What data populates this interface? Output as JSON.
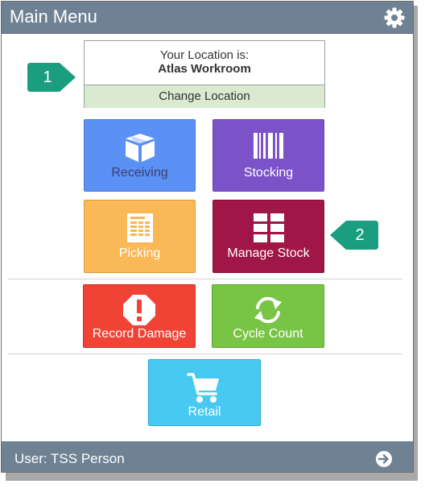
{
  "header": {
    "title": "Main Menu",
    "settings_icon": "gear-icon"
  },
  "location": {
    "label": "Your Location is:",
    "name": "Atlas Workroom",
    "change_label": "Change Location"
  },
  "tiles": {
    "receiving": {
      "label": "Receiving",
      "icon": "package-icon",
      "color": "#5b91f5"
    },
    "stocking": {
      "label": "Stocking",
      "icon": "barcode-icon",
      "color": "#7c52c9"
    },
    "picking": {
      "label": "Picking",
      "icon": "pick-list-icon",
      "color": "#fbb856"
    },
    "manage_stock": {
      "label": "Manage Stock",
      "icon": "grid-icon",
      "color": "#a01646"
    },
    "record_damage": {
      "label": "Record Damage",
      "icon": "warning-icon",
      "color": "#f04336"
    },
    "cycle_count": {
      "label": "Cycle Count",
      "icon": "cycle-icon",
      "color": "#78c444"
    },
    "retail": {
      "label": "Retail",
      "icon": "cart-icon",
      "color": "#48c9f2"
    }
  },
  "footer": {
    "user_label": "User: TSS Person",
    "logout_icon": "arrow-right-circle-icon"
  },
  "callouts": [
    {
      "label": "1"
    },
    {
      "label": "2"
    }
  ],
  "colors": {
    "header_bg": "#6f8294",
    "callout": "#1b9e80"
  }
}
